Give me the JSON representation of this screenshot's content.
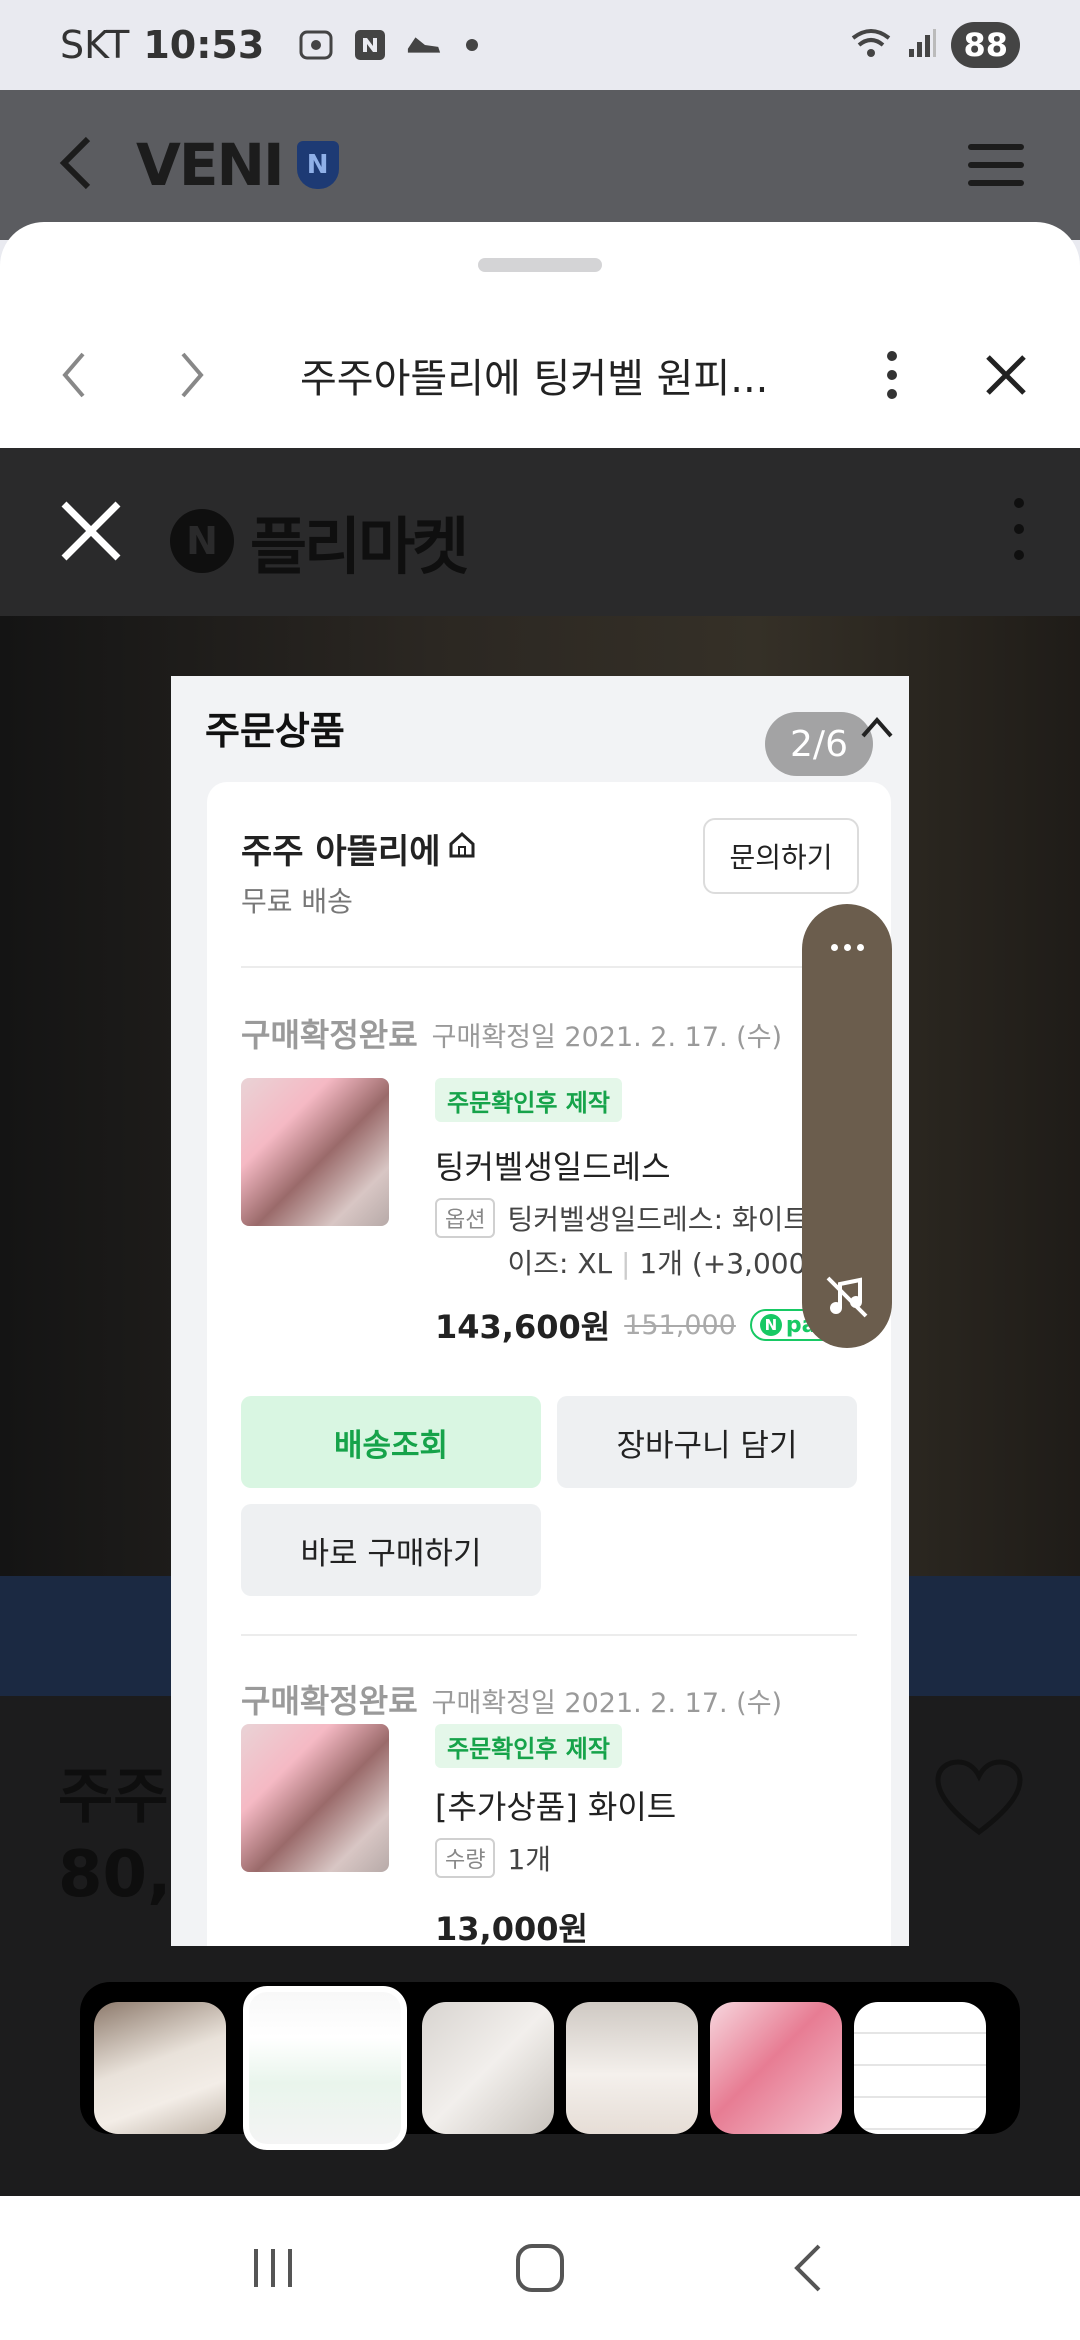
{
  "status_bar": {
    "carrier": "SKT",
    "time": "10:53",
    "battery": "88",
    "icons": [
      "screenshot-icon",
      "naver-n-icon",
      "shoe-icon",
      "dot-icon",
      "wifi-icon",
      "signal-icon"
    ]
  },
  "background_app": {
    "logo": "VENI",
    "shield_letter": "N",
    "product_title_partial": "주주",
    "price_partial": "80,("
  },
  "sheet": {
    "title": "주주아뜰리에 팅커벨 원피..."
  },
  "viewer": {
    "brand_letter": "N",
    "brand_text": "플리마켓",
    "counter": "2/6"
  },
  "card": {
    "title": "주문상품",
    "seller": "주주 아뜰리에",
    "shipping": "무료 배송",
    "inquiry_label": "문의하기",
    "orders": [
      {
        "status": "구매확정완료",
        "date": "구매확정일 2021. 2. 17. (수)",
        "badge": "주문확인후 제작",
        "name": "팅커벨생일드레스",
        "option_tag": "옵션",
        "option_text": "팅커벨생일드레스: 화이트 / 사이즈: XL",
        "option_qty": "1개 (+3,000원)",
        "price": "143,600원",
        "old_price": "151,000",
        "npay": "pay"
      },
      {
        "status": "구매확정완료",
        "date": "구매확정일 2021. 2. 17. (수)",
        "badge": "주문확인후 제작",
        "name": "[추가상품] 화이트",
        "option_tag": "수량",
        "option_text": "1개",
        "price": "13,000원"
      }
    ],
    "buttons": {
      "track": "배송조회",
      "cart": "장바구니 담기",
      "buy_now": "바로 구매하기"
    }
  },
  "colors": {
    "accent_green": "#16a34a",
    "npay_green": "#17c964",
    "pill_brown": "#6b5d4d"
  }
}
